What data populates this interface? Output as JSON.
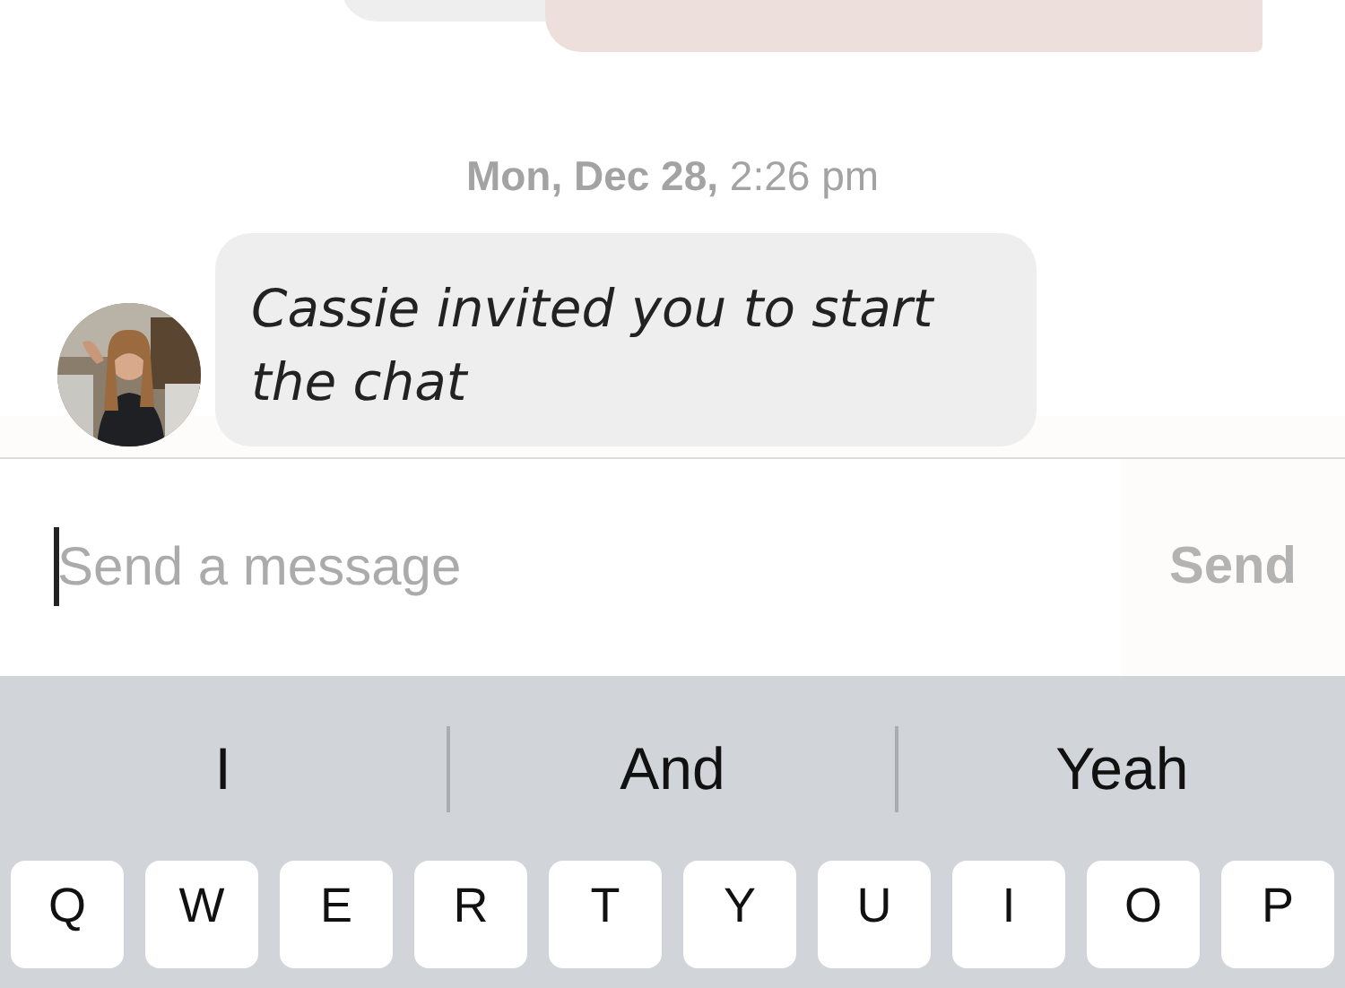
{
  "earlier_messages": [
    {
      "kind": "received"
    },
    {
      "kind": "sent"
    }
  ],
  "timestamp": "**Mon, Dec 28,** 2:26 pm",
  "message": {
    "text": "Cassie invited you to start the chat",
    "kind": "received"
  },
  "composer": {
    "placeholder": "Send a message",
    "send_button": "Send"
  },
  "keyboard": {
    "suggestions": [
      "I",
      "And",
      "Yeah"
    ],
    "keys": [
      "Q",
      "W",
      "E",
      "R",
      "T",
      "Y",
      "U",
      "I",
      "O",
      "P"
    ]
  }
}
